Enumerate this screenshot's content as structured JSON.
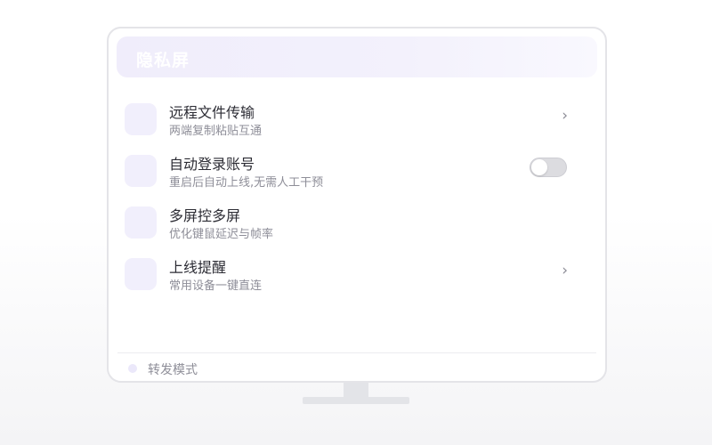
{
  "header": {
    "title": "隐私屏"
  },
  "menu_items": [
    {
      "title": "远程文件传输",
      "subtitle": "两端复制粘贴互通",
      "trailing": "chevron",
      "chevron_glyph": "›"
    },
    {
      "title": "自动登录账号",
      "subtitle": "重启后自动上线,无需人工干预",
      "trailing": "toggle",
      "toggle_on": false
    },
    {
      "title": "多屏控多屏",
      "subtitle": "优化键鼠延迟与帧率",
      "trailing": "none"
    },
    {
      "title": "上线提醒",
      "subtitle": "常用设备一键直连",
      "trailing": "chevron",
      "chevron_glyph": "›"
    }
  ],
  "footer": {
    "label": "转发模式"
  },
  "colors": {
    "accent_light": "#f1effc",
    "toggle_off": "#dcdce0"
  }
}
